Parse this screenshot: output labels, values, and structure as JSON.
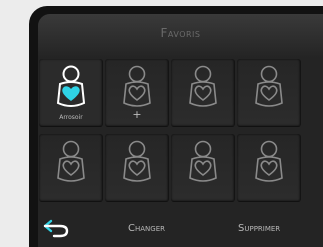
{
  "header": {
    "title": "Favoris"
  },
  "slots": [
    {
      "label": "Arrosoir",
      "state": "selected",
      "icon": "user-heart-icon"
    },
    {
      "label": "+",
      "state": "empty",
      "icon": "user-heart-icon"
    },
    {
      "label": "",
      "state": "empty",
      "icon": "user-heart-icon"
    },
    {
      "label": "",
      "state": "empty",
      "icon": "user-heart-icon"
    },
    {
      "label": "",
      "state": "empty",
      "icon": "user-heart-icon"
    },
    {
      "label": "",
      "state": "empty",
      "icon": "user-heart-icon"
    },
    {
      "label": "",
      "state": "empty",
      "icon": "user-heart-icon"
    },
    {
      "label": "",
      "state": "empty",
      "icon": "user-heart-icon"
    }
  ],
  "footer": {
    "back_icon": "back-arrow-icon",
    "change_label": "Changer",
    "delete_label": "Supprimer"
  },
  "colors": {
    "accent": "#2fd3e6",
    "icon_outline": "#8a8a8a",
    "icon_outline_active": "#ffffff"
  }
}
